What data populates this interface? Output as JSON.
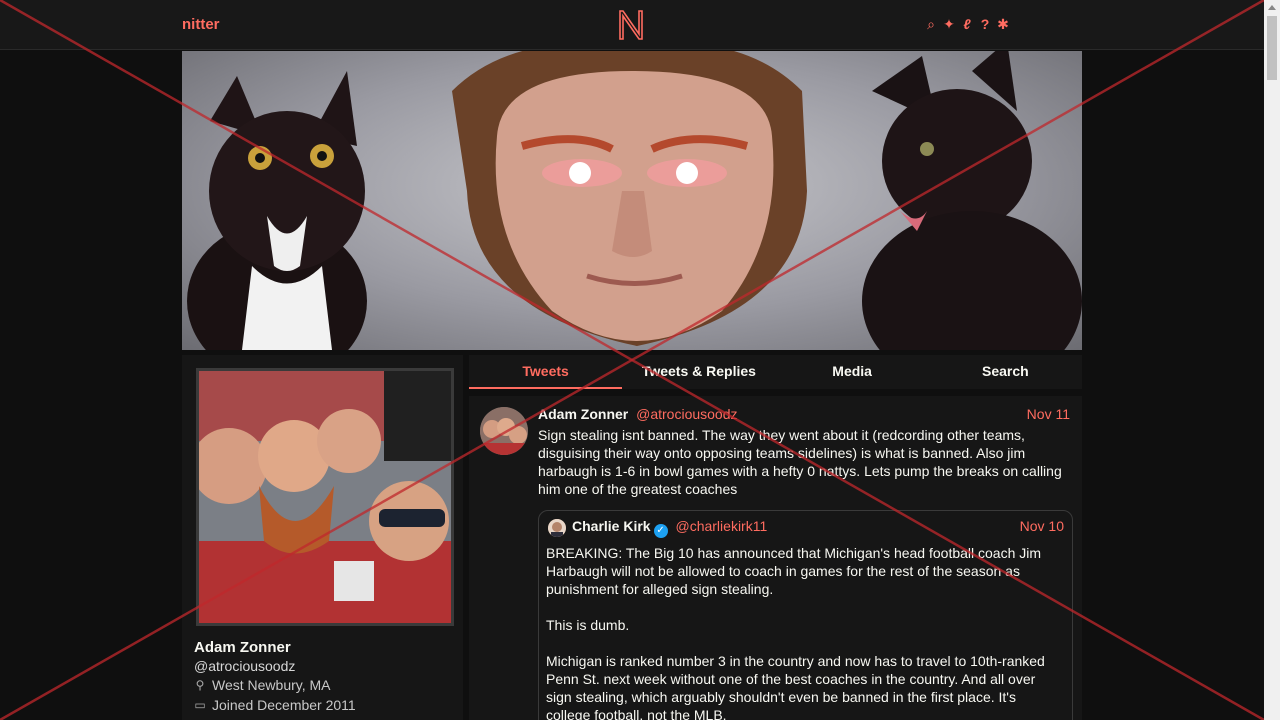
{
  "navbar": {
    "brand": "nitter",
    "logo_letter": "N",
    "icons": [
      "search-icon",
      "bird-icon",
      "rss-icon",
      "help-icon",
      "settings-icon"
    ]
  },
  "profile": {
    "fullname": "Adam Zonner",
    "username": "@atrociousoodz",
    "location": "West Newbury, MA",
    "joined": "Joined December 2011"
  },
  "tabs": [
    {
      "label": "Tweets",
      "active": true
    },
    {
      "label": "Tweets & Replies",
      "active": false
    },
    {
      "label": "Media",
      "active": false
    },
    {
      "label": "Search",
      "active": false
    }
  ],
  "tweet": {
    "fullname": "Adam Zonner",
    "username": "@atrociousoodz",
    "date": "Nov 11",
    "text": "Sign stealing isnt banned. The way they went about it (redcording other teams, disguising their way onto opposing teams sidelines) is what is banned. Also jim harbaugh is 1-6 in bowl games with a hefty 0 nattys. Lets pump the breaks on calling him one of the greatest coaches",
    "quote": {
      "fullname": "Charlie Kirk",
      "username": "@charliekirk11",
      "date": "Nov 10",
      "paragraphs": [
        "BREAKING: The Big 10 has announced that Michigan's head football coach Jim Harbaugh will not be allowed to coach in games for the rest of the season as punishment for alleged sign stealing.",
        "This is dumb.",
        "Michigan is ranked number 3 in the country and now has to travel to 10th-ranked Penn St. next week without one of the best coaches in the country. And all over sign stealing, which arguably shouldn't even be banned in the first place. It's college football, not the MLB."
      ]
    }
  },
  "colors": {
    "accent": "#ff6c60",
    "background": "#0f0f0f",
    "panel": "#161616",
    "verified": "#1da1f2"
  }
}
